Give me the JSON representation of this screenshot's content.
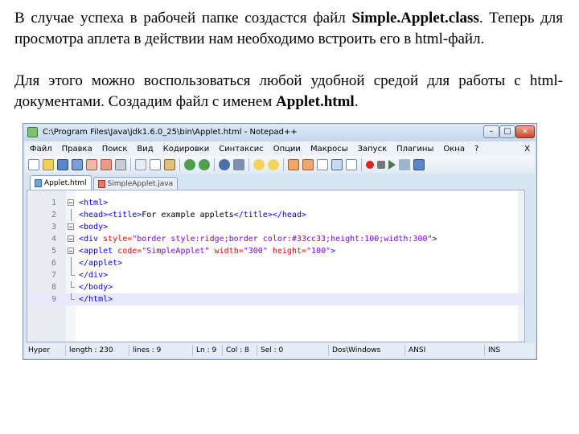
{
  "text": {
    "p1_a": "В случае успеха в рабочей папке создастся файл ",
    "p1_b": "Simple.Applet.class",
    "p1_c": ". Теперь для просмотра аплета в действии нам необходимо встроить его в html-файл.",
    "p2_a": "Для этого можно воспользоваться любой удобной средой для работы с html-документами. Создадим файл с именем ",
    "p2_b": "Applet.html",
    "p2_c": "."
  },
  "window": {
    "title": "C:\\Program Files\\Java\\jdk1.6.0_25\\bin\\Applet.html - Notepad++",
    "controls": {
      "minimize": "–",
      "maximize": "□",
      "close": "×"
    }
  },
  "menu": {
    "items": [
      "Файл",
      "Правка",
      "Поиск",
      "Вид",
      "Кодировки",
      "Синтаксис",
      "Опции",
      "Макросы",
      "Запуск",
      "Плагины",
      "Окна",
      "?"
    ],
    "close": "X"
  },
  "toolbar": {
    "icons": [
      "new-file-icon",
      "open-icon",
      "save-icon",
      "save-all-icon",
      "close-file-icon",
      "close-all-icon",
      "print-icon",
      "cut-icon",
      "copy-icon",
      "paste-icon",
      "undo-icon",
      "redo-icon",
      "find-icon",
      "replace-icon",
      "zoom-in-icon",
      "zoom-out-icon",
      "sync-v-icon",
      "sync-h-icon",
      "wrap-icon",
      "all-chars-icon",
      "indent-guide-icon",
      "macro-record-icon",
      "macro-stop-icon",
      "macro-play-icon",
      "macro-run-icon",
      "macro-save-icon"
    ]
  },
  "tabs": [
    {
      "label": "Applet.html",
      "active": true
    },
    {
      "label": "SimpleApplet.java",
      "active": false
    }
  ],
  "code": {
    "lines": [
      {
        "n": "1",
        "parts": [
          [
            "tag",
            "<html>"
          ]
        ]
      },
      {
        "n": "2",
        "parts": [
          [
            "tag",
            "<head><title>"
          ],
          [
            "txt",
            "For example applets"
          ],
          [
            "tag",
            "</title></head>"
          ]
        ]
      },
      {
        "n": "3",
        "parts": [
          [
            "tag",
            "<body>"
          ]
        ]
      },
      {
        "n": "4",
        "parts": [
          [
            "tag",
            "<div "
          ],
          [
            "attr",
            "style="
          ],
          [
            "val",
            "\"border style:ridge;border color:#33cc33;height:100;width:300\""
          ],
          [
            "tag",
            ">"
          ]
        ]
      },
      {
        "n": "5",
        "parts": [
          [
            "tag",
            "<applet "
          ],
          [
            "attr",
            "code="
          ],
          [
            "val",
            "\"SimpleApplet\""
          ],
          [
            "tag",
            " "
          ],
          [
            "attr",
            "width="
          ],
          [
            "val",
            "\"300\""
          ],
          [
            "tag",
            " "
          ],
          [
            "attr",
            "height="
          ],
          [
            "val",
            "\"100\""
          ],
          [
            "tag",
            ">"
          ]
        ]
      },
      {
        "n": "6",
        "parts": [
          [
            "tag",
            "</applet>"
          ]
        ]
      },
      {
        "n": "7",
        "parts": [
          [
            "tag",
            "</div>"
          ]
        ]
      },
      {
        "n": "8",
        "parts": [
          [
            "tag",
            "</body>"
          ]
        ]
      },
      {
        "n": "9",
        "parts": [
          [
            "tag",
            "</html>"
          ]
        ]
      }
    ]
  },
  "status": {
    "type": "Hyper",
    "length": "length : 230",
    "lines": "lines : 9",
    "ln": "Ln : 9",
    "col": "Col : 8",
    "sel": "Sel : 0",
    "eol": "Dos\\Windows",
    "encoding": "ANSI",
    "mode": "INS"
  },
  "colors": {
    "tag": "#0000ff",
    "attribute": "#ff0000",
    "value": "#8000ff",
    "current_line": "#e8e8ff"
  }
}
